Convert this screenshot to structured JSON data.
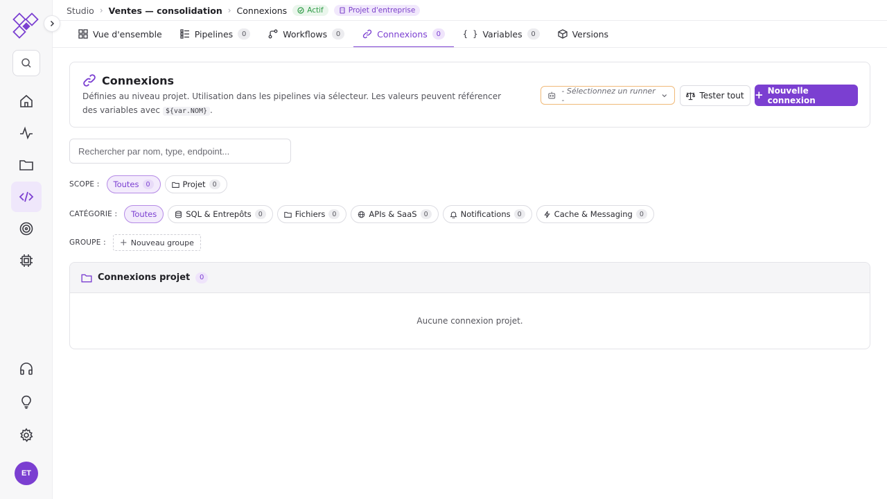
{
  "breadcrumb": {
    "root": "Studio",
    "project": "Ventes — consolidation",
    "current": "Connexions",
    "status_badge": "Actif",
    "type_badge": "Projet d'entreprise"
  },
  "tabs": [
    {
      "label": "Vue d'ensemble",
      "count": null
    },
    {
      "label": "Pipelines",
      "count": "0"
    },
    {
      "label": "Workflows",
      "count": "0"
    },
    {
      "label": "Connexions",
      "count": "0"
    },
    {
      "label": "Variables",
      "count": "0"
    },
    {
      "label": "Versions",
      "count": null
    }
  ],
  "header": {
    "title": "Connexions",
    "description_prefix": "Définies au niveau projet. Utilisation dans les pipelines via sélecteur. Les valeurs peuvent référencer des variables avec",
    "code": "${var.NOM}",
    "description_suffix": ".",
    "runner_placeholder": "- Sélectionnez un runner -",
    "test_all_label": "Tester tout",
    "new_connection_label": "Nouvelle connexion"
  },
  "search": {
    "placeholder": "Rechercher par nom, type, endpoint..."
  },
  "filters": {
    "scope_label": "SCOPE :",
    "scope": [
      {
        "label": "Toutes",
        "count": "0",
        "active": true
      },
      {
        "label": "Projet",
        "count": "0",
        "active": false
      }
    ],
    "category_label": "CATÉGORIE :",
    "category_all": "Toutes",
    "categories": [
      {
        "label": "SQL & Entrepôts",
        "count": "0"
      },
      {
        "label": "Fichiers",
        "count": "0"
      },
      {
        "label": "APIs & SaaS",
        "count": "0"
      },
      {
        "label": "Notifications",
        "count": "0"
      },
      {
        "label": "Cache & Messaging",
        "count": "0"
      }
    ],
    "group_label": "GROUPE :",
    "new_group_label": "Nouveau groupe"
  },
  "group": {
    "title": "Connexions projet",
    "count": "0",
    "empty_text": "Aucune connexion projet."
  },
  "user": {
    "initials": "ET"
  },
  "colors": {
    "accent": "#7b3fd1",
    "status_green": "#2e9b46",
    "warning_border": "#f0b978"
  }
}
